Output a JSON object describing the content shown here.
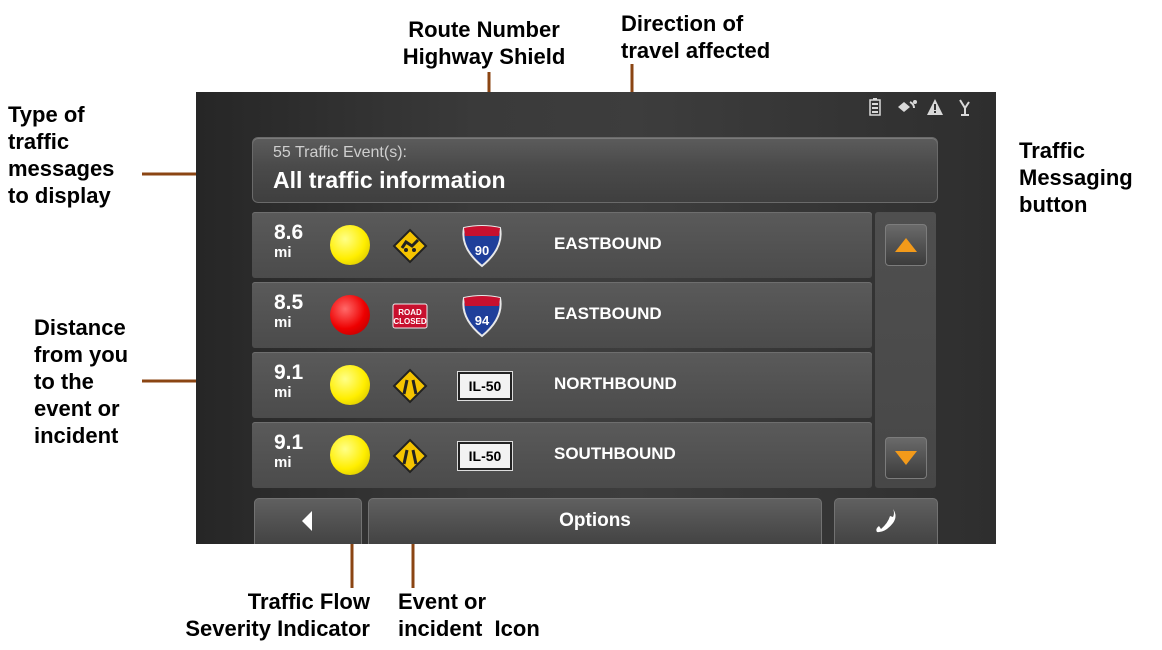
{
  "callouts": {
    "type_of_messages": [
      "Type of",
      "traffic",
      "messages",
      "to display"
    ],
    "distance": [
      "Distance",
      "from you",
      "to the",
      "event or",
      "incident"
    ],
    "route": [
      "Route Number",
      "Highway Shield"
    ],
    "direction": [
      "Direction of",
      "travel affected"
    ],
    "traffic_button": [
      "Traffic",
      "Messaging",
      "button"
    ],
    "severity": [
      "Traffic Flow",
      "Severity Indicator"
    ],
    "event": [
      "Event or",
      "incident  Icon"
    ]
  },
  "screen": {
    "status_icons": [
      "battery-icon",
      "satellite-dish-icon",
      "warning-triangle-icon",
      "gps-signal-icon"
    ],
    "traffic_button": {
      "count_text": "55 Traffic Event(s):",
      "type_text": "All traffic information"
    },
    "events": [
      {
        "distance": "8.6",
        "unit": "mi",
        "severity": "yellow",
        "event_icon": "road-hazard-icon",
        "route": "90",
        "route_type": "interstate",
        "direction": "EASTBOUND"
      },
      {
        "distance": "8.5",
        "unit": "mi",
        "severity": "red",
        "event_icon": "road-closed-icon",
        "event_icon_text": [
          "ROAD",
          "CLOSED"
        ],
        "route": "94",
        "route_type": "interstate",
        "direction": "EASTBOUND"
      },
      {
        "distance": "9.1",
        "unit": "mi",
        "severity": "yellow",
        "event_icon": "road-narrows-icon",
        "route": "IL-50",
        "route_type": "state",
        "direction": "NORTHBOUND"
      },
      {
        "distance": "9.1",
        "unit": "mi",
        "severity": "yellow",
        "event_icon": "road-narrows-icon",
        "route": "IL-50",
        "route_type": "state",
        "direction": "SOUTHBOUND"
      }
    ],
    "bottom_bar": {
      "options_label": "Options"
    }
  },
  "colors": {
    "severity_yellow": "#ffee00",
    "severity_red": "#ee0000",
    "accent_orange": "#f39a1a",
    "interstate_blue": "#1f3f9a",
    "interstate_red": "#c8102e",
    "leader_line": "#8b4513"
  }
}
